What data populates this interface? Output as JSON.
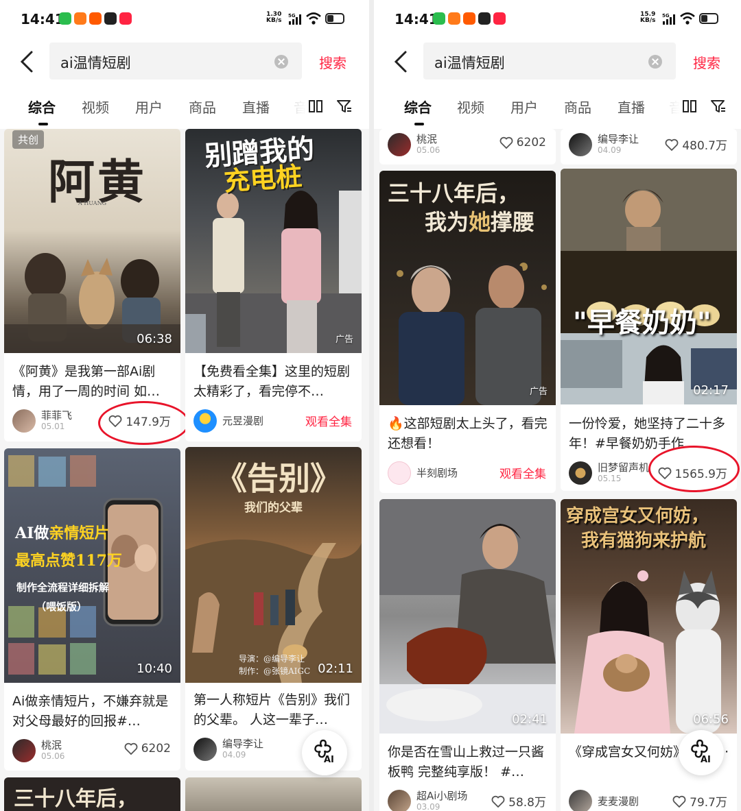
{
  "accent_color": "#ff2442",
  "highlight_color": "#e8142a",
  "left": {
    "status": {
      "time": "14:41",
      "speed_top": "1.30",
      "speed_bottom": "KB/s",
      "network": "5G"
    },
    "search": {
      "query": "ai温情短剧",
      "button": "搜索"
    },
    "tabs": [
      "综合",
      "视频",
      "用户",
      "商品",
      "直播",
      "音"
    ],
    "cards": [
      {
        "tag": "共创",
        "duration": "06:38",
        "title": "《阿黄》是我第一部Ai剧情，用了一周的时间 如…",
        "author": "菲菲飞",
        "date": "05.01",
        "likes": "147.9万",
        "poster": {
          "title": "阿黄",
          "sub": "A HUANG"
        }
      },
      {
        "ad": "广告",
        "title": "【免费看全集】这里的短剧太精彩了，看完停不…",
        "author": "元昱漫剧",
        "watch": "观看全集",
        "poster": {
          "line1": "别蹭我的",
          "line2": "充电桩"
        }
      },
      {
        "duration": "10:40",
        "title": "Ai做亲情短片，不嫌弃就是对父母最好的回报#…",
        "author": "桃泯",
        "date": "05.06",
        "likes": "6202",
        "poster": {
          "line1": "AI做",
          "line1b": "亲情短片",
          "line2": "最高点赞117万",
          "line3": "制作全流程详细拆解",
          "line4": "（喂饭版）"
        }
      },
      {
        "duration": "02:11",
        "title": "第一人称短片《告别》我们的父辈。 人这一辈子…",
        "author": "编导李让",
        "date": "04.09",
        "poster": {
          "title": "《告别》",
          "sub": "我们的父辈",
          "credit1": "导演：@编导李让",
          "credit2": "制作：@张镜AIGC"
        }
      }
    ],
    "peek_text": "三十八年后，",
    "ai_label": "AI"
  },
  "right": {
    "status": {
      "time": "14:41",
      "speed_top": "15.9",
      "speed_bottom": "KB/s",
      "network": "5G"
    },
    "search": {
      "query": "ai温情短剧",
      "button": "搜索"
    },
    "tabs": [
      "综合",
      "视频",
      "用户",
      "商品",
      "直播",
      "音"
    ],
    "top_meta": [
      {
        "author": "桃泯",
        "date": "05.06",
        "likes": "6202"
      },
      {
        "author": "编导李让",
        "date": "04.09",
        "likes": "480.7万"
      }
    ],
    "cards": [
      {
        "ad": "广告",
        "title": "🔥这部短剧太上头了，看完还想看！",
        "author": "半刻剧场",
        "watch": "观看全集",
        "poster": {
          "line1": "三十八年后，",
          "line2": "我为",
          "line2b": "她",
          "line2c": "撑腰"
        }
      },
      {
        "duration": "02:17",
        "title": "一份怜爱，她坚持了二十多年！#早餐奶奶手作…",
        "author": "旧梦留声机",
        "date": "05.15",
        "likes": "1565.9万",
        "poster": {
          "title": "\"早餐奶奶\""
        }
      },
      {
        "duration": "02:41",
        "title": "你是否在雪山上救过一只酱板鸭 完整纯享版！ #…",
        "author": "超Ai小剧场",
        "date": "03.09",
        "likes": "58.8万"
      },
      {
        "duration": "06:56",
        "title": "《穿成宫女又何妨》1-3集 ·",
        "author": "麦麦漫剧",
        "likes": "79.7万",
        "poster": {
          "line1": "穿成宫女又何妨，",
          "line2": "我有猫狗来护航"
        }
      }
    ],
    "ai_label": "AI"
  }
}
